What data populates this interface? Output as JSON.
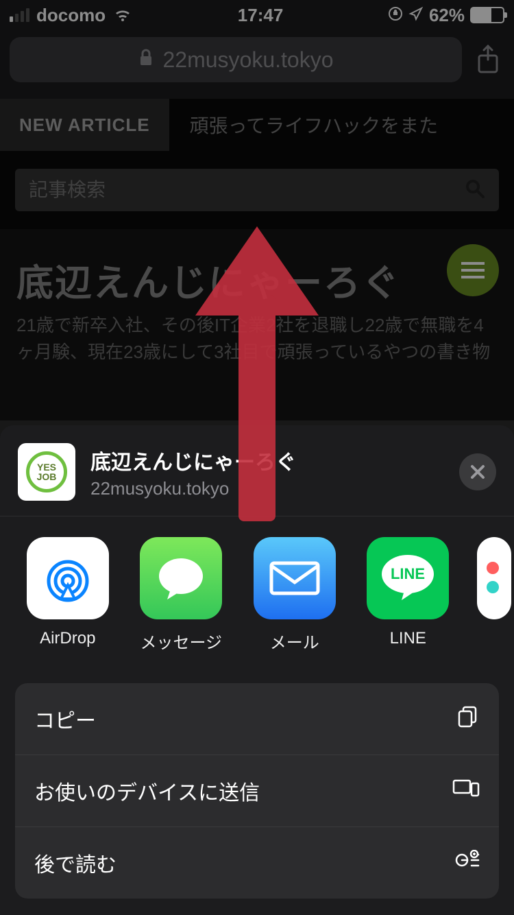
{
  "status": {
    "carrier": "docomo",
    "time": "17:47",
    "battery_pct": "62%"
  },
  "urlbar": {
    "domain": "22musyoku.tokyo"
  },
  "page": {
    "new_article_label": "NEW ARTICLE",
    "ticker": "頑張ってライフハックをまた",
    "search_placeholder": "記事検索",
    "site_title": "底辺えんじにゃーろぐ",
    "site_sub": "21歳で新卒入社、その後IT企業2社を退職し22歳で無職を4ヶ月験、現在23歳にして3社目で頑張っているやつの書き物"
  },
  "share": {
    "title": "底辺えんじにゃーろぐ",
    "subtitle": "22musyoku.tokyo",
    "thumb_line1": "YES",
    "thumb_line2": "JOB",
    "apps": [
      {
        "label": "AirDrop"
      },
      {
        "label": "メッセージ"
      },
      {
        "label": "メール"
      },
      {
        "label": "LINE"
      }
    ],
    "actions": [
      {
        "label": "コピー"
      },
      {
        "label": "お使いのデバイスに送信"
      },
      {
        "label": "後で読む"
      }
    ]
  }
}
